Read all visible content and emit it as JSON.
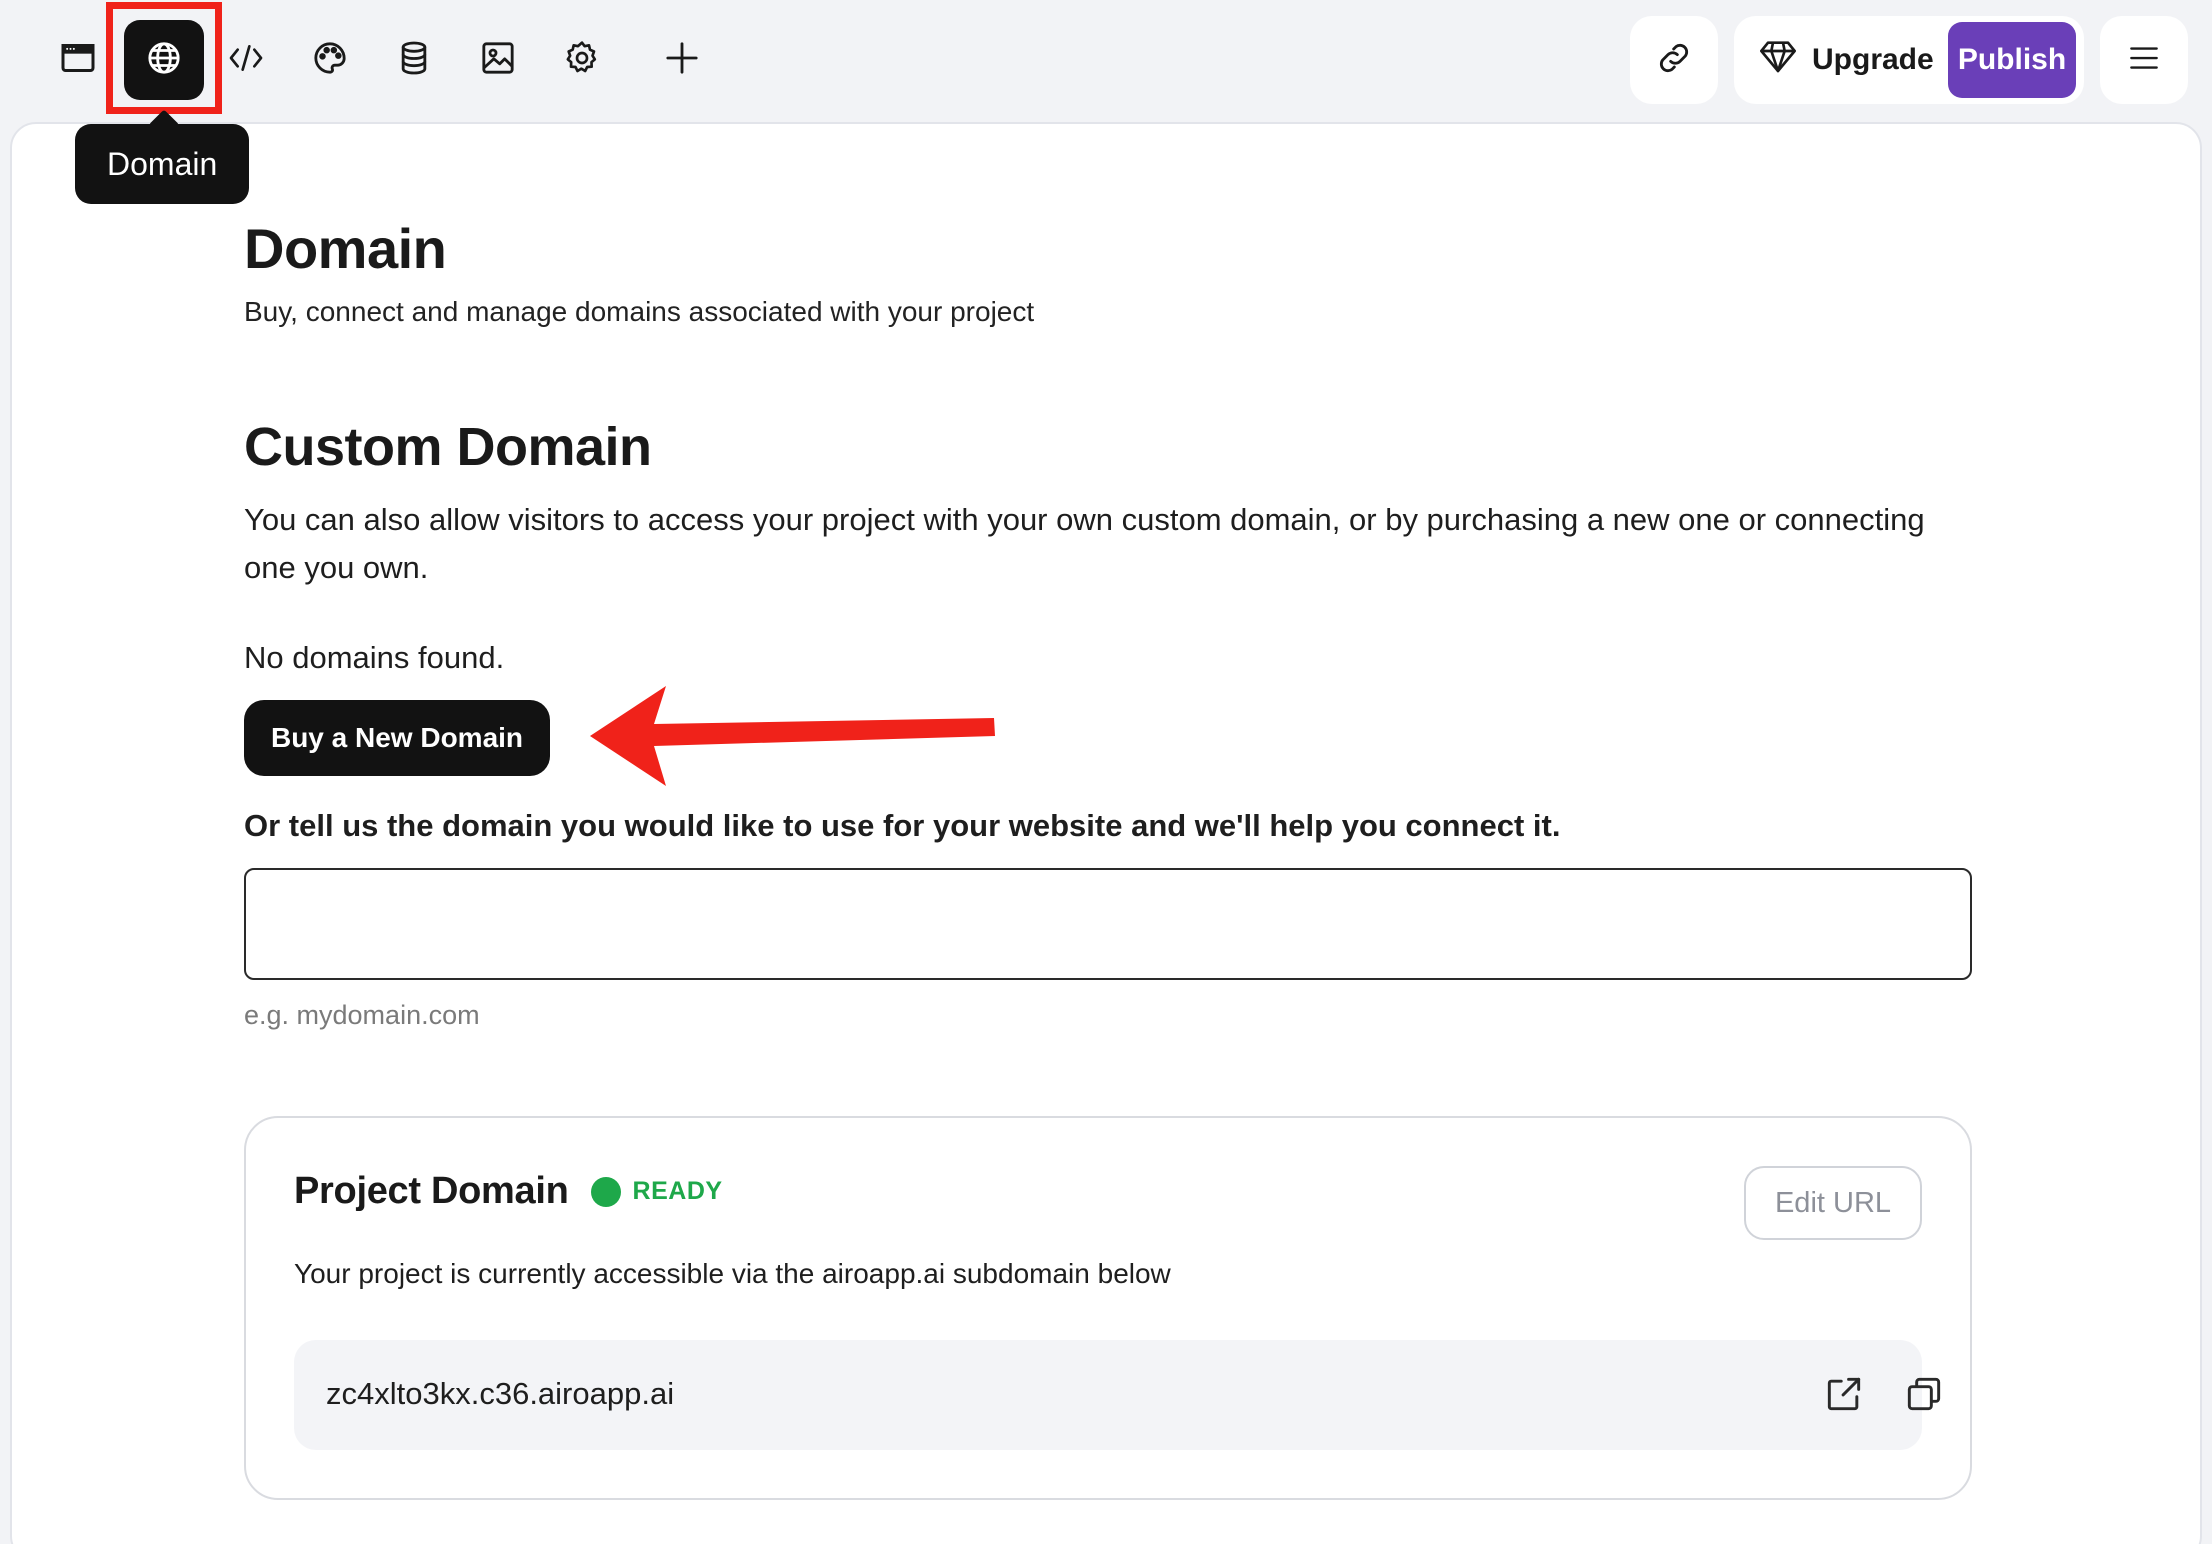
{
  "toolbar": {
    "tools": [
      {
        "name": "browser-window-icon"
      },
      {
        "name": "globe-icon",
        "active": true
      },
      {
        "name": "code-icon"
      },
      {
        "name": "palette-icon"
      },
      {
        "name": "database-icon"
      },
      {
        "name": "image-icon"
      },
      {
        "name": "gear-icon"
      },
      {
        "name": "plus-icon"
      }
    ],
    "tooltip": "Domain",
    "upgrade_label": "Upgrade",
    "publish_label": "Publish",
    "publish_color": "#6a3fb8"
  },
  "page": {
    "title": "Domain",
    "subtitle": "Buy, connect and manage domains associated with your project"
  },
  "custom_domain": {
    "title": "Custom Domain",
    "description": "You can also allow visitors to access your project with your own custom domain, or by purchasing a new one or connecting one you own.",
    "empty_text": "No domains found.",
    "buy_button": "Buy a New Domain",
    "connect_text": "Or tell us the domain you would like to use for your website and we'll help you connect it.",
    "input_value": "",
    "hint": "e.g. mydomain.com"
  },
  "project_domain": {
    "title": "Project Domain",
    "status": "READY",
    "status_color": "#1ea84a",
    "edit_button": "Edit URL",
    "description": "Your project is currently accessible via the airoapp.ai subdomain below",
    "url": "zc4xlto3kx.c36.airoapp.ai"
  }
}
